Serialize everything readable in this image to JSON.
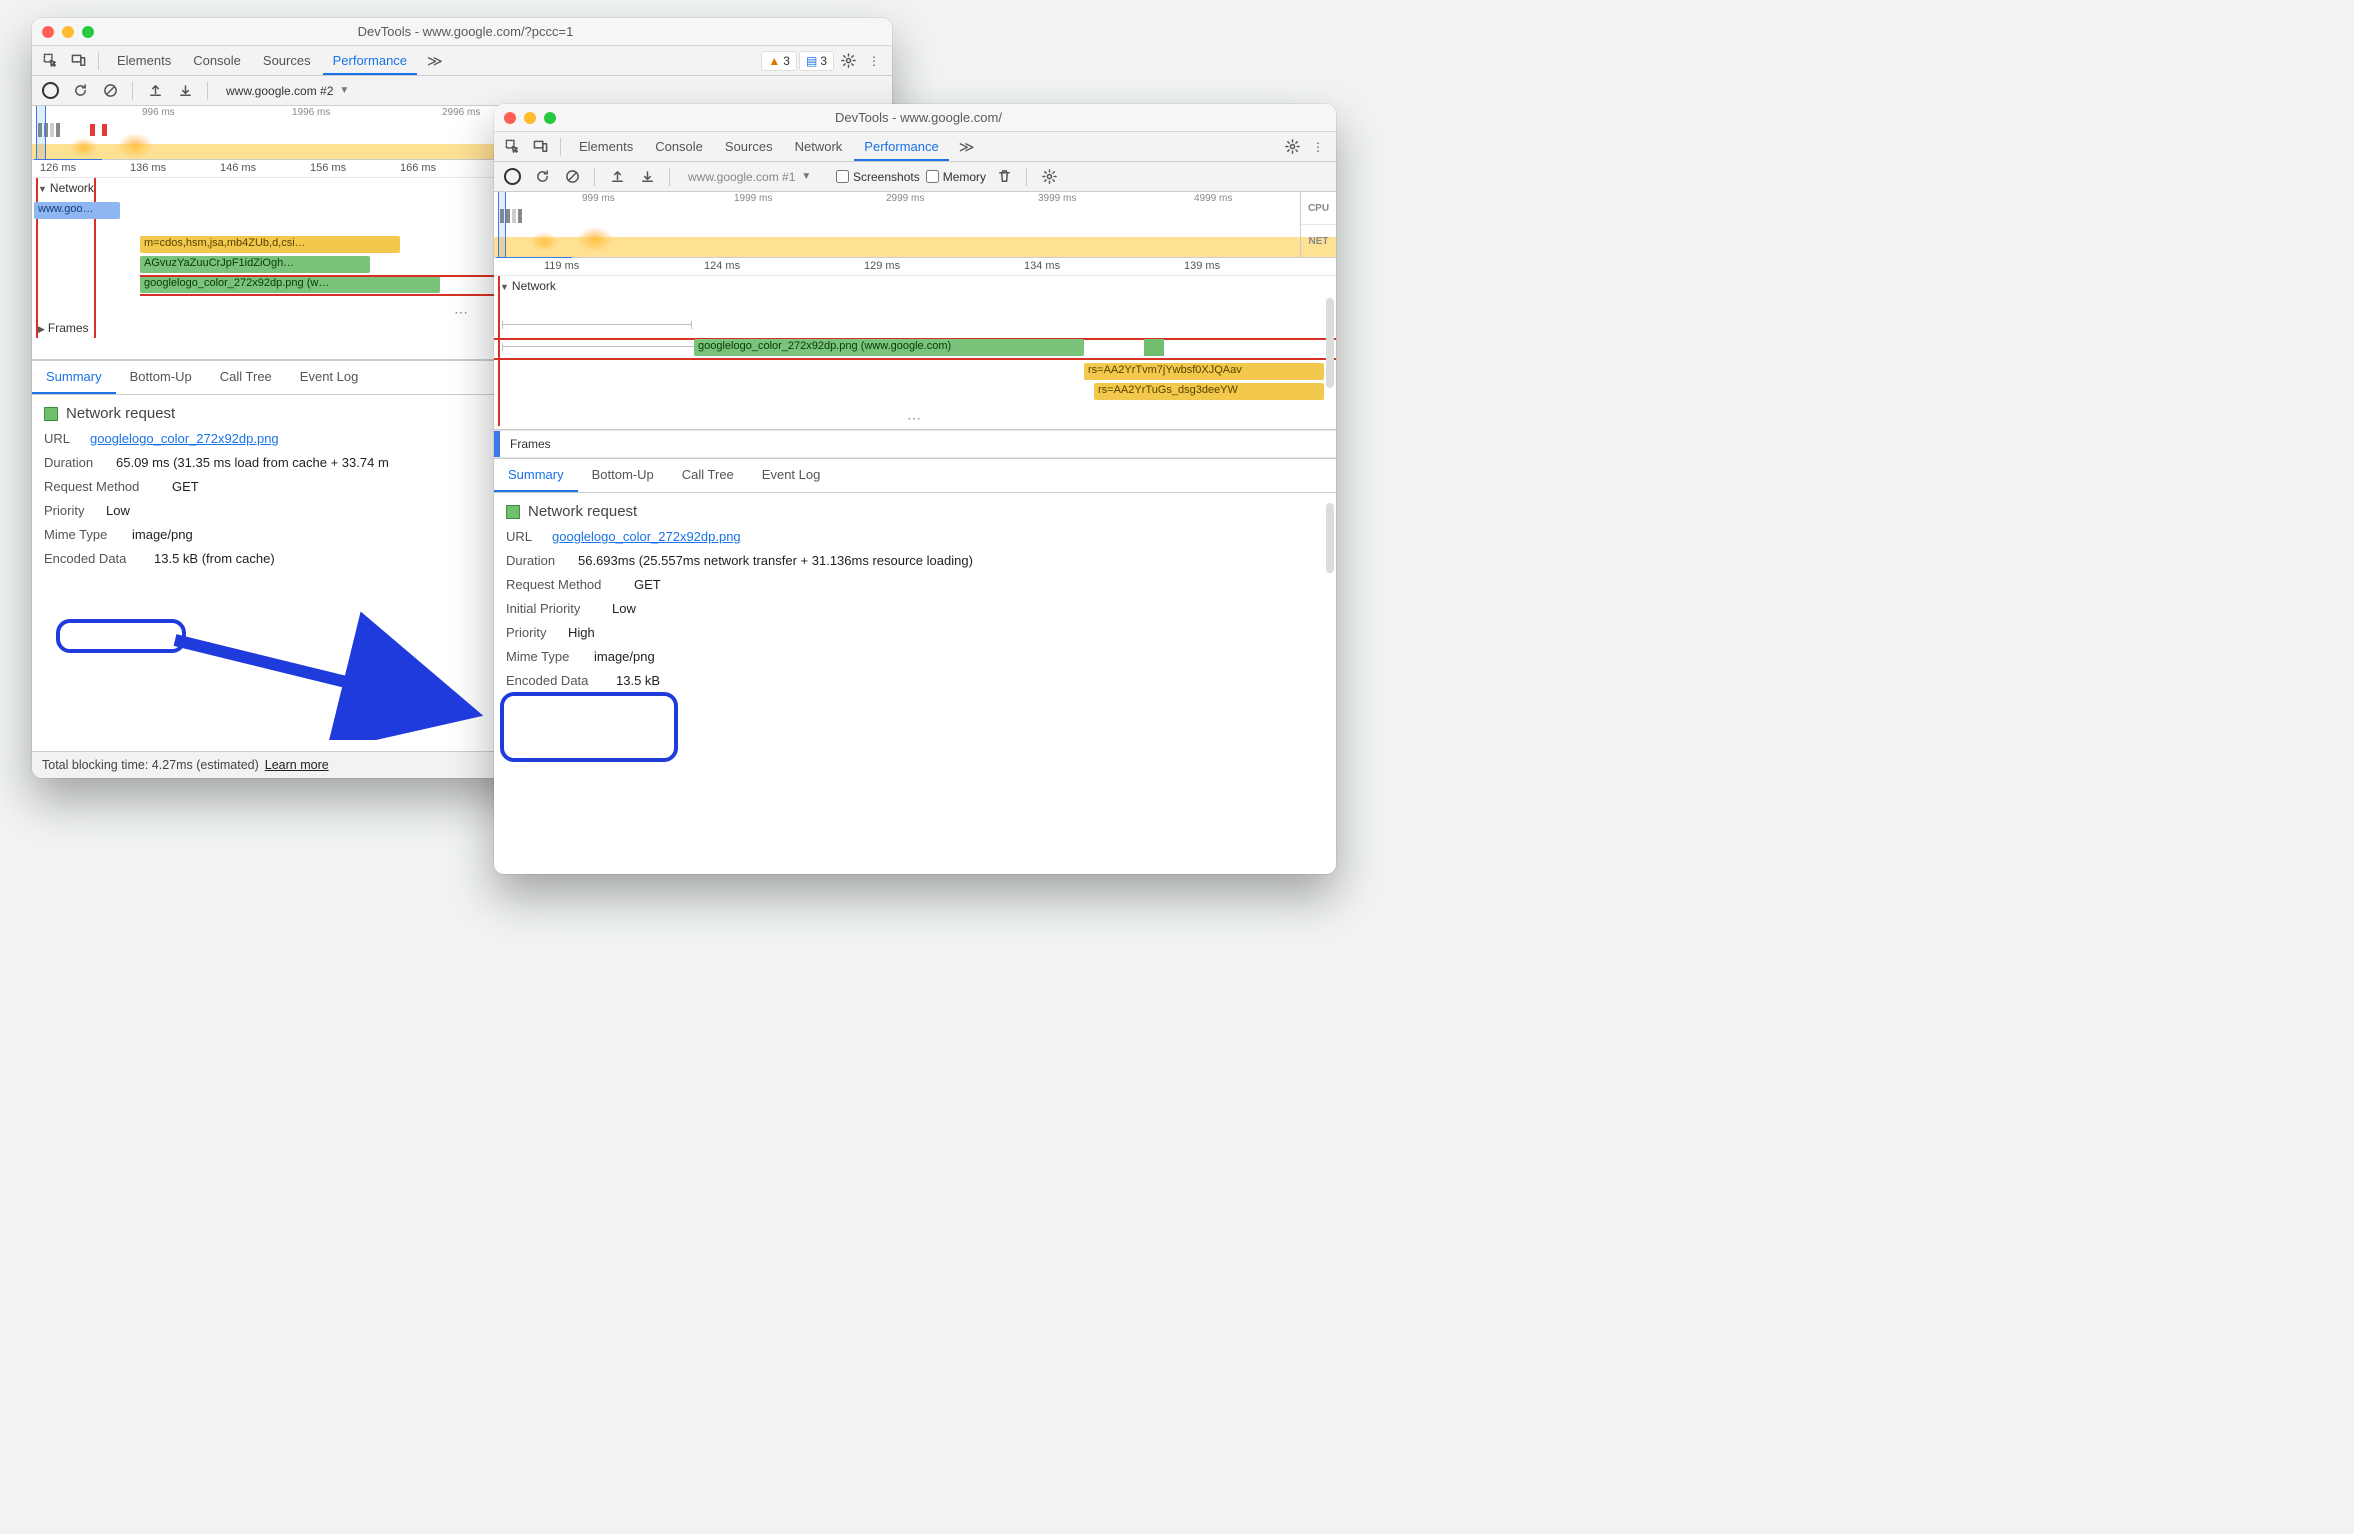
{
  "left": {
    "title": "DevTools - www.google.com/?pccc=1",
    "tabs": [
      "Elements",
      "Console",
      "Sources",
      "Performance"
    ],
    "activeTab": "Performance",
    "badges": {
      "warn": "3",
      "info": "3"
    },
    "recording": "www.google.com #2",
    "overview_ticks": [
      "996 ms",
      "1996 ms",
      "2996 ms"
    ],
    "ruler": [
      "126 ms",
      "136 ms",
      "146 ms",
      "156 ms",
      "166 ms"
    ],
    "networkLabel": "Network",
    "bars": {
      "blue": "www.goo…",
      "yellow": "m=cdos,hsm,jsa,mb4ZUb,d,csi…",
      "green1": "AGvuzYaZuuCrJpF1idZiOgh…",
      "green2": "googlelogo_color_272x92dp.png (w…"
    },
    "framesLabel": "Frames",
    "detailTabs": [
      "Summary",
      "Bottom-Up",
      "Call Tree",
      "Event Log"
    ],
    "detailActive": "Summary",
    "sectionTitle": "Network request",
    "url_label": "URL",
    "url": "googlelogo_color_272x92dp.png",
    "duration_label": "Duration",
    "duration": "65.09 ms (31.35 ms load from cache + 33.74 m",
    "method_label": "Request Method",
    "method": "GET",
    "priority_label": "Priority",
    "priority": "Low",
    "mime_label": "Mime Type",
    "mime": "image/png",
    "encoded_label": "Encoded Data",
    "encoded": "13.5 kB (from cache)",
    "footer": "Total blocking time: 4.27ms (estimated)",
    "footer_link": "Learn more"
  },
  "right": {
    "title": "DevTools - www.google.com/",
    "tabs": [
      "Elements",
      "Console",
      "Sources",
      "Network",
      "Performance"
    ],
    "activeTab": "Performance",
    "recording": "www.google.com #1",
    "checks": {
      "screenshots": "Screenshots",
      "memory": "Memory"
    },
    "overview_ticks": [
      "999 ms",
      "1999 ms",
      "2999 ms",
      "3999 ms",
      "4999 ms"
    ],
    "side_labels": [
      "CPU",
      "NET"
    ],
    "ruler": [
      "119 ms",
      "124 ms",
      "129 ms",
      "134 ms",
      "139 ms"
    ],
    "networkLabel": "Network",
    "bars": {
      "green_main": "googlelogo_color_272x92dp.png (www.google.com)",
      "yellow1": "rs=AA2YrTvm7jYwbsf0XJQAav",
      "yellow2": "rs=AA2YrTuGs_dsg3deeYW"
    },
    "framesLabel": "Frames",
    "detailTabs": [
      "Summary",
      "Bottom-Up",
      "Call Tree",
      "Event Log"
    ],
    "detailActive": "Summary",
    "sectionTitle": "Network request",
    "url_label": "URL",
    "url": "googlelogo_color_272x92dp.png",
    "duration_label": "Duration",
    "duration": "56.693ms (25.557ms network transfer + 31.136ms resource loading)",
    "method_label": "Request Method",
    "method": "GET",
    "init_priority_label": "Initial Priority",
    "init_priority": "Low",
    "priority_label": "Priority",
    "priority": "High",
    "mime_label": "Mime Type",
    "mime": "image/png",
    "encoded_label": "Encoded Data",
    "encoded": "13.5 kB"
  }
}
